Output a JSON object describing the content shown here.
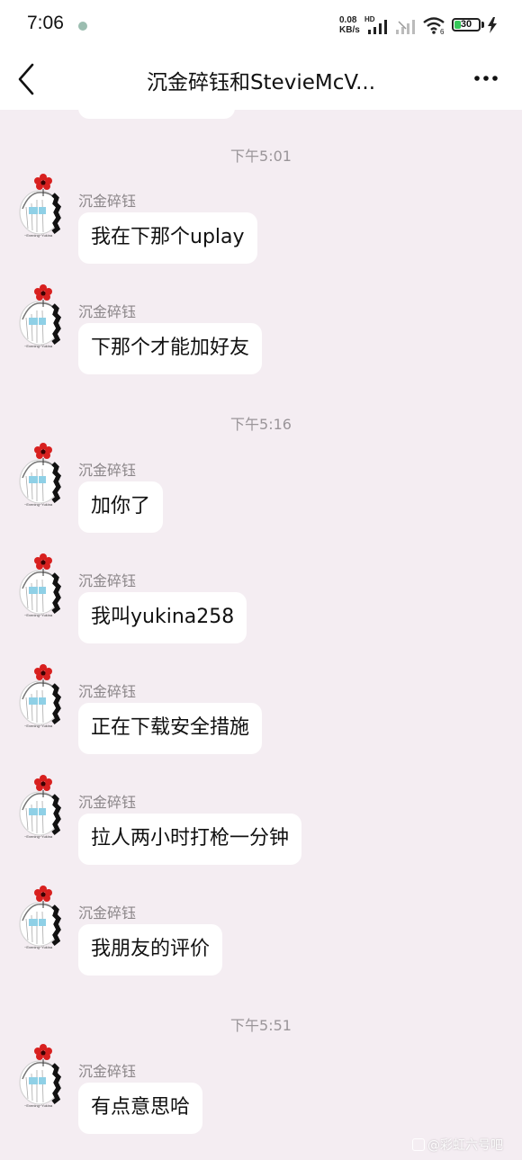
{
  "status_bar": {
    "time": "7:06",
    "net_speed_value": "0.08",
    "net_speed_unit": "KB/s",
    "net_type": "HD",
    "wifi_sub": "6",
    "battery_level": 30,
    "battery_text": "30",
    "icons": [
      "app-notification-icon",
      "signal-icon",
      "signal-icon",
      "wifi-icon",
      "battery-icon",
      "charging-icon"
    ]
  },
  "header": {
    "title": "沉金碎钰和StevieMcV...",
    "back_icon": "chevron-left-icon",
    "more_icon": "more-dots-icon"
  },
  "colors": {
    "background": "#f4edf2",
    "bubble": "#ffffff",
    "timestamp_text": "#9a9599",
    "sender_text": "#8b8689",
    "battery_green": "#35c759",
    "avatar_flower": "#d8201f"
  },
  "messages": {
    "ts1": "下午5:01",
    "m1": {
      "sender": "沉金碎钰",
      "text": "我在下那个uplay"
    },
    "m2": {
      "sender": "沉金碎钰",
      "text": "下那个才能加好友"
    },
    "ts2": "下午5:16",
    "m3": {
      "sender": "沉金碎钰",
      "text": "加你了"
    },
    "m4": {
      "sender": "沉金碎钰",
      "text": "我叫yukina258"
    },
    "m5": {
      "sender": "沉金碎钰",
      "text": "正在下载安全措施"
    },
    "m6": {
      "sender": "沉金碎钰",
      "text": "拉人两小时打枪一分钟"
    },
    "m7": {
      "sender": "沉金碎钰",
      "text": "我朋友的评价"
    },
    "ts3": "下午5:51",
    "m8": {
      "sender": "沉金碎钰",
      "text": "有点意思哈"
    }
  },
  "watermark": "@彩虹六号吧"
}
